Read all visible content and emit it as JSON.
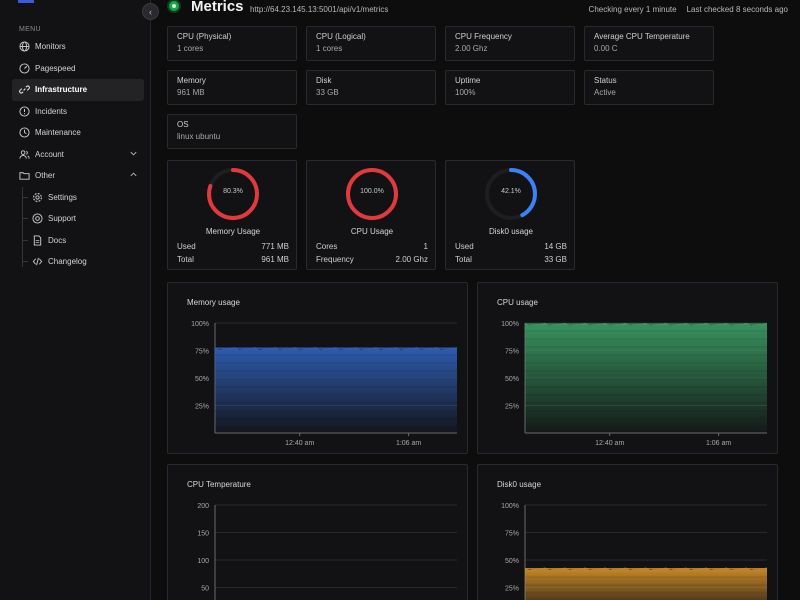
{
  "sidebar": {
    "menu_label": "MENU",
    "items": [
      {
        "label": "Monitors",
        "icon": "globe-icon"
      },
      {
        "label": "Pagespeed",
        "icon": "gauge-icon"
      },
      {
        "label": "Infrastructure",
        "icon": "link-icon",
        "active": true
      },
      {
        "label": "Incidents",
        "icon": "alert-circle-icon"
      },
      {
        "label": "Maintenance",
        "icon": "clock-icon"
      },
      {
        "label": "Account",
        "icon": "user-group-icon",
        "chevron": "down"
      },
      {
        "label": "Other",
        "icon": "folder-icon",
        "chevron": "up"
      }
    ],
    "sub_items": [
      {
        "label": "Settings",
        "icon": "gear-icon"
      },
      {
        "label": "Support",
        "icon": "lifebuoy-icon"
      },
      {
        "label": "Docs",
        "icon": "document-icon"
      },
      {
        "label": "Changelog",
        "icon": "code-icon"
      }
    ]
  },
  "header": {
    "title": "Metrics",
    "url": "http://64.23.145.13:5001/api/v1/metrics",
    "checking": "Checking every 1 minute",
    "last_checked": "Last checked 8 seconds ago",
    "status_color": "#1aa34a"
  },
  "stats": [
    {
      "label": "CPU (Physical)",
      "value": "1 cores"
    },
    {
      "label": "CPU (Logical)",
      "value": "1 cores"
    },
    {
      "label": "CPU Frequency",
      "value": "2.00 Ghz"
    },
    {
      "label": "Average CPU Temperature",
      "value": "0.00 C"
    },
    {
      "label": "Memory",
      "value": "961 MB"
    },
    {
      "label": "Disk",
      "value": "33 GB"
    },
    {
      "label": "Uptime",
      "value": "100%"
    },
    {
      "label": "Status",
      "value": "Active"
    },
    {
      "label": "OS",
      "value": "linux ubuntu"
    }
  ],
  "gauges": [
    {
      "name": "Memory Usage",
      "display": "80.3%",
      "percent": 80.3,
      "color": "#e0393e",
      "row1_label": "Used",
      "row1_value": "771 MB",
      "row2_label": "Total",
      "row2_value": "961 MB"
    },
    {
      "name": "CPU Usage",
      "display": "100.0%",
      "percent": 100,
      "color": "#e0393e",
      "row1_label": "Cores",
      "row1_value": "1",
      "row2_label": "Frequency",
      "row2_value": "2.00 Ghz"
    },
    {
      "name": "Disk0 usage",
      "display": "42.1%",
      "percent": 42.1,
      "color": "#3b82f6",
      "row1_label": "Used",
      "row1_value": "14 GB",
      "row2_label": "Total",
      "row2_value": "33 GB"
    }
  ],
  "chart_data": [
    {
      "type": "area",
      "title": "Memory usage",
      "y_ticks": [
        "100%",
        "75%",
        "50%",
        "25%"
      ],
      "x_ticks": [
        "12:40 am",
        "1:06 am"
      ],
      "ylim": [
        0,
        100
      ],
      "level": 77,
      "color": "#2f5fb8"
    },
    {
      "type": "area",
      "title": "CPU usage",
      "y_ticks": [
        "100%",
        "75%",
        "50%",
        "25%"
      ],
      "x_ticks": [
        "12:40 am",
        "1:06 am"
      ],
      "ylim": [
        0,
        100
      ],
      "level": 99,
      "color": "#3a9a62"
    },
    {
      "type": "area",
      "title": "CPU Temperature",
      "y_ticks": [
        "200",
        "150",
        "100",
        "50"
      ],
      "x_ticks": [],
      "ylim": [
        0,
        200
      ],
      "level": 0,
      "color": "#888888"
    },
    {
      "type": "area",
      "title": "Disk0 usage",
      "y_ticks": [
        "100%",
        "75%",
        "50%",
        "25%"
      ],
      "x_ticks": [],
      "ylim": [
        0,
        100
      ],
      "level": 42,
      "color": "#d4902a"
    }
  ]
}
